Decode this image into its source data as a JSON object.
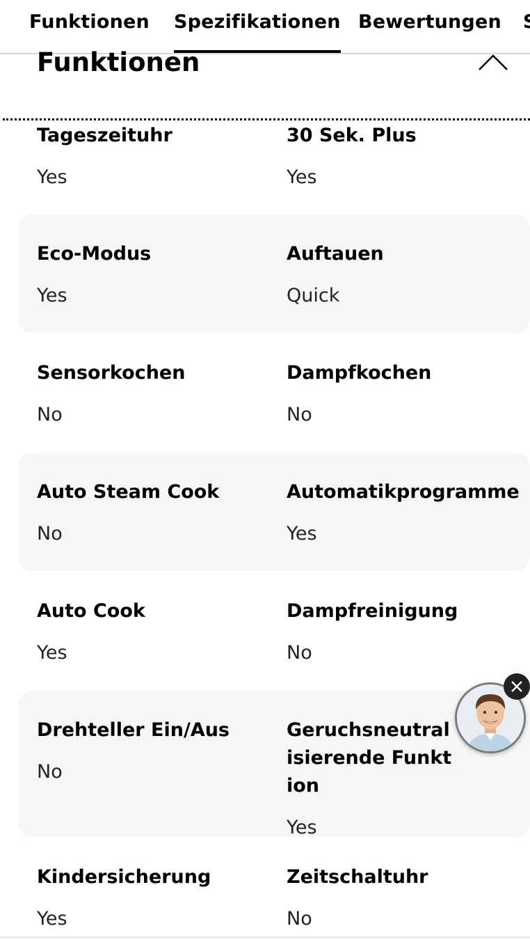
{
  "tabs": [
    {
      "label": "Funktionen",
      "active": false
    },
    {
      "label": "Spezifikationen",
      "active": true
    },
    {
      "label": "Bewertungen",
      "active": false
    },
    {
      "label": "S",
      "active": false
    }
  ],
  "section": {
    "title": "Funktionen",
    "collapse_icon": "chevron-up-icon"
  },
  "specs": [
    {
      "left": {
        "label": "Tageszeituhr",
        "value": "Yes"
      },
      "right": {
        "label": "30 Sek. Plus",
        "value": "Yes"
      }
    },
    {
      "left": {
        "label": "Eco-Modus",
        "value": "Yes"
      },
      "right": {
        "label": "Auftauen",
        "value": "Quick"
      }
    },
    {
      "left": {
        "label": "Sensorkochen",
        "value": "No"
      },
      "right": {
        "label": "Dampfkochen",
        "value": "No"
      }
    },
    {
      "left": {
        "label": "Auto Steam Cook",
        "value": "No"
      },
      "right": {
        "label": "Automatikprogramme",
        "value": "Yes"
      }
    },
    {
      "left": {
        "label": "Auto Cook",
        "value": "Yes"
      },
      "right": {
        "label": "Dampfreinigung",
        "value": "No"
      }
    },
    {
      "left": {
        "label": "Drehteller Ein/Aus",
        "value": "No"
      },
      "right": {
        "label": "Geruchsneutralisierende Funktion",
        "value": "Yes"
      }
    },
    {
      "left": {
        "label": "Kindersicherung",
        "value": "Yes"
      },
      "right": {
        "label": "Zeitschaltuhr",
        "value": "No"
      }
    }
  ],
  "chat_widget": {
    "avatar_icon": "support-agent-avatar",
    "close_icon": "close-icon"
  }
}
